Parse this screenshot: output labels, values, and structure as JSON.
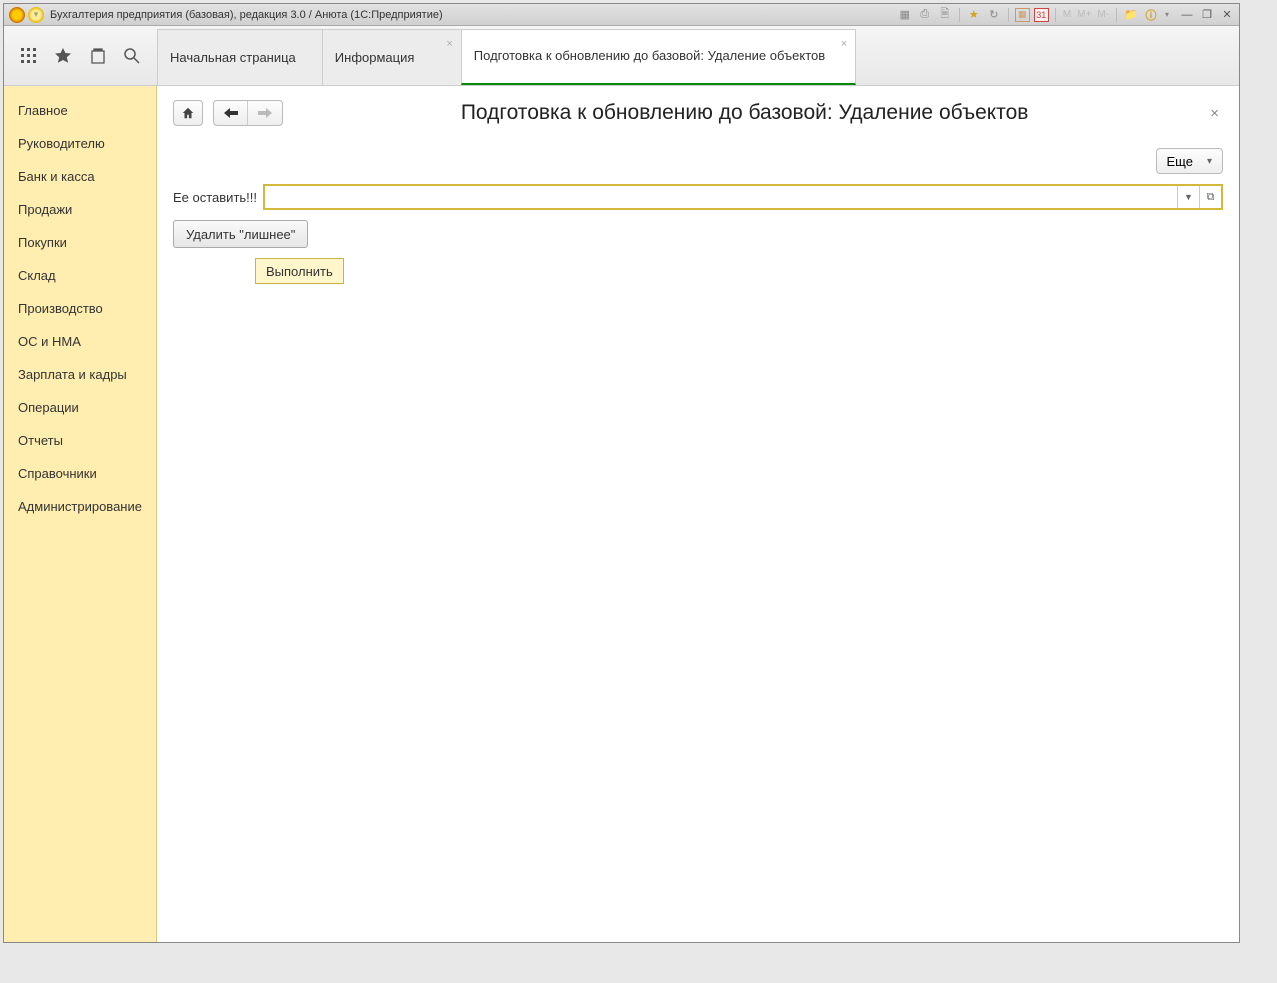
{
  "titlebar": {
    "title": "Бухгалтерия предприятия (базовая), редакция 3.0 / Анюта  (1С:Предприятие)",
    "m_labels": [
      "M",
      "M+",
      "M-"
    ],
    "cal1": "31",
    "cal2": "31"
  },
  "tabs": [
    {
      "label": "Начальная страница",
      "closable": false
    },
    {
      "label": "Информация",
      "closable": true
    },
    {
      "label": "Подготовка к обновлению до базовой: Удаление объектов",
      "closable": true,
      "active": true
    }
  ],
  "sidebar": {
    "items": [
      {
        "label": "Главное"
      },
      {
        "label": "Руководителю"
      },
      {
        "label": "Банк и касса"
      },
      {
        "label": "Продажи"
      },
      {
        "label": "Покупки"
      },
      {
        "label": "Склад"
      },
      {
        "label": "Производство"
      },
      {
        "label": "ОС и НМА"
      },
      {
        "label": "Зарплата и кадры"
      },
      {
        "label": "Операции"
      },
      {
        "label": "Отчеты"
      },
      {
        "label": "Справочники"
      },
      {
        "label": "Администрирование"
      }
    ]
  },
  "content": {
    "page_title": "Подготовка к обновлению до базовой: Удаление объектов",
    "more_label": "Еще",
    "field_label": "Ее оставить!!!",
    "field_value": "",
    "delete_btn": "Удалить \"лишнее\"",
    "exec_btn": "Выполнить"
  }
}
